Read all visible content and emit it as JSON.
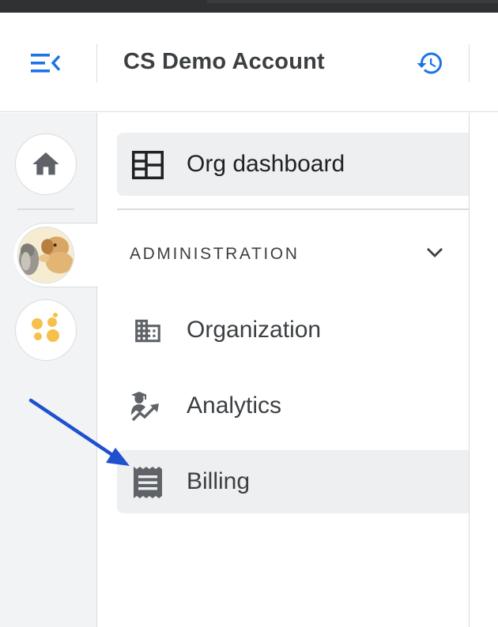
{
  "header": {
    "menu_icon": "menu-collapse-icon",
    "account_title": "CS Demo Account",
    "history_icon": "history-icon"
  },
  "rail": {
    "items": [
      {
        "name": "home",
        "icon": "home-icon"
      },
      {
        "name": "organization-avatar",
        "icon": "pets-photo-avatar"
      },
      {
        "name": "app-switcher",
        "icon": "dots-app-icon"
      }
    ]
  },
  "nav": {
    "dashboard": {
      "label": "Org dashboard",
      "icon": "dashboard-icon"
    },
    "section": {
      "label": "ADMINISTRATION",
      "expanded": true,
      "icon": "chevron-down-icon"
    },
    "items": [
      {
        "label": "Organization",
        "icon": "building-icon"
      },
      {
        "label": "Analytics",
        "icon": "analytics-icon"
      },
      {
        "label": "Billing",
        "icon": "receipt-icon"
      }
    ]
  },
  "colors": {
    "accent": "#1a73e8",
    "annotation": "#1e50d0",
    "rail_bg": "#f1f3f4",
    "selected_bg": "#eeeff0",
    "text": "#3c4043"
  }
}
